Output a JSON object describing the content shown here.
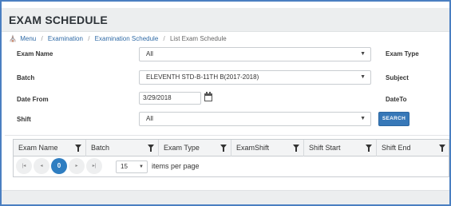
{
  "page": {
    "title": "EXAM SCHEDULE"
  },
  "breadcrumb": {
    "items": [
      "Menu",
      "Examination",
      "Examination Schedule",
      "List Exam Schedule"
    ],
    "separator": "/"
  },
  "form": {
    "exam_name": {
      "label": "Exam Name",
      "value": "All"
    },
    "batch": {
      "label": "Batch",
      "value": "ELEVENTH STD-B-11TH B(2017-2018)"
    },
    "date_from": {
      "label": "Date From",
      "value": "3/29/2018"
    },
    "shift": {
      "label": "Shift",
      "value": "All"
    },
    "exam_type": {
      "label": "Exam Type"
    },
    "subject": {
      "label": "Subject"
    },
    "date_to": {
      "label": "DateTo"
    },
    "search_label": "SEARCH"
  },
  "grid": {
    "columns": [
      "Exam Name",
      "Batch",
      "Exam Type",
      "ExamShift",
      "Shift Start",
      "Shift End"
    ],
    "pager": {
      "first": "|◂",
      "prev": "◂",
      "current_page": "0",
      "next": "▸",
      "last": "▸|",
      "page_size": "15",
      "items_per_page_label": "items per page"
    }
  },
  "colors": {
    "accent": "#2f7ec1",
    "search_button": "#3778b8",
    "frame_border": "#4a7fc1"
  },
  "icons": [
    "home-icon",
    "calendar-icon",
    "filter-icon",
    "chevron-down-icon"
  ]
}
